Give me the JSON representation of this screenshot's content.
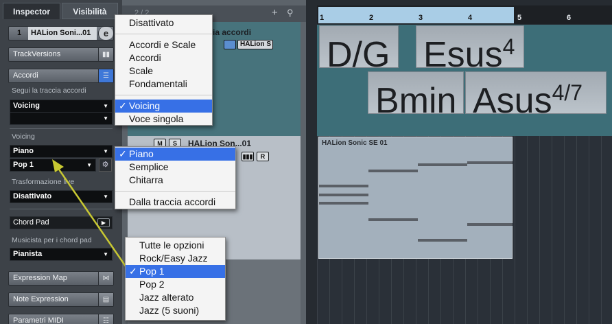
{
  "inspector": {
    "tabs": [
      "Inspector",
      "Visibilità"
    ],
    "track_number": "1",
    "track_name": "HALion Soni...01",
    "trackversions_label": "TrackVersions",
    "accordi_label": "Accordi",
    "segui_label": "Segui la traccia accordi",
    "segui_value": "Voicing",
    "voicing_label": "Voicing",
    "voicing_type": "Piano",
    "voicing_style": "Pop 1",
    "trasformazione_label": "Trasformazione live",
    "trasformazione_value": "Disattivato",
    "chordpad_label": "Chord Pad",
    "musicista_label": "Musicista per i chord pad",
    "musicista_value": "Pianista",
    "expression_map": "Expression Map",
    "note_expression": "Note Expression",
    "parametri_midi": "Parametri MIDI"
  },
  "tracklist": {
    "header_count": "2 / 2",
    "track1_name": "ia accordi",
    "track1_instrument": "HALion S",
    "track2_name": "HALion Son...01"
  },
  "ruler": [
    "1",
    "2",
    "3",
    "4",
    "5",
    "6"
  ],
  "chords": [
    {
      "root": "D/G",
      "ext": ""
    },
    {
      "root": "Esus",
      "ext": "4"
    },
    {
      "root": "Bmin",
      "ext": ""
    },
    {
      "root": "Asus",
      "ext": "4/7"
    }
  ],
  "part_name": "HALion Sonic SE 01",
  "menu_follow": {
    "items": [
      "Disattivato",
      "Accordi e Scale",
      "Accordi",
      "Scale",
      "Fondamentali",
      "Voicing",
      "Voce singola"
    ],
    "selected": "Voicing"
  },
  "menu_voicing": {
    "items": [
      "Piano",
      "Semplice",
      "Chitarra",
      "Dalla traccia accordi"
    ],
    "selected": "Piano"
  },
  "menu_style": {
    "items": [
      "Tutte le opzioni",
      "Rock/Easy Jazz",
      "Pop 1",
      "Pop 2",
      "Jazz alterato",
      "Jazz (5 suoni)"
    ],
    "selected": "Pop 1"
  },
  "colors": {
    "accent": "#3770e6",
    "cycle": "#a9cde6",
    "arrow": "#c8c832"
  }
}
